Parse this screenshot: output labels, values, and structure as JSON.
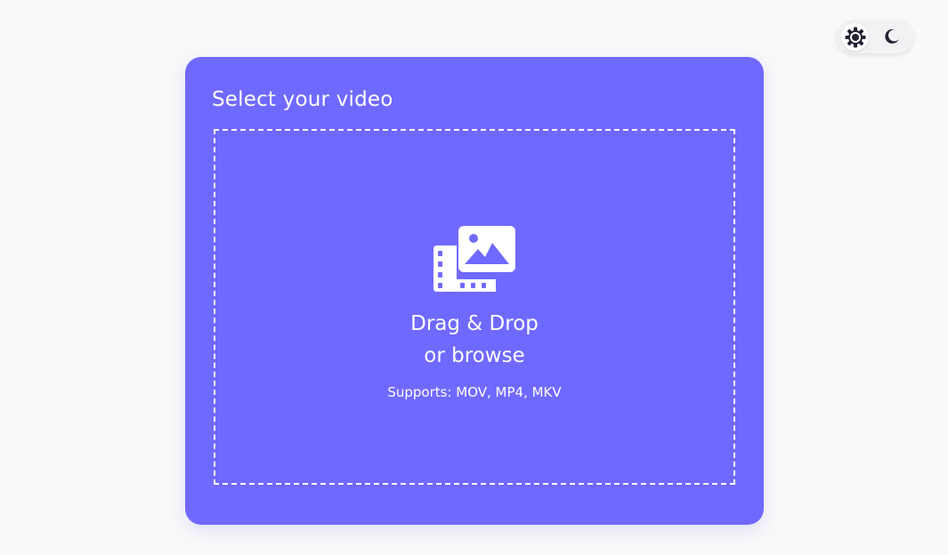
{
  "theme_toggle": {
    "light_icon": "gear-sun-icon",
    "dark_icon": "moon-icon",
    "selected": "light"
  },
  "upload": {
    "title": "Select your video",
    "icon": "image-film-icon",
    "drop_line1": "Drag & Drop",
    "drop_line2": "or browse",
    "supports": "Supports: MOV, MP4, MKV"
  },
  "colors": {
    "card": "#7069ff",
    "page_background": "#f9f9f9",
    "text": "#ffffff",
    "icon_dark": "#222233"
  }
}
